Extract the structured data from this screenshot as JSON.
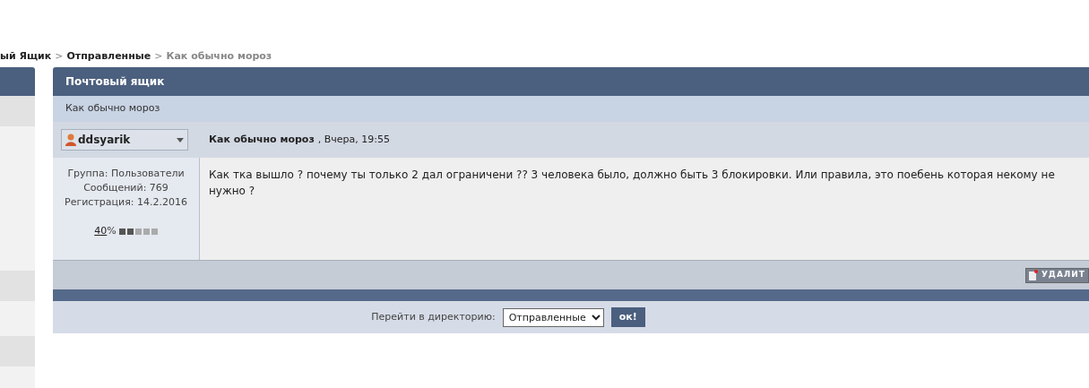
{
  "breadcrumb": [
    {
      "label": "ый Ящик",
      "current": false
    },
    {
      "label": "Отправленные",
      "current": false
    },
    {
      "label": "Как обычно мороз",
      "current": true
    }
  ],
  "breadcrumb_separator": ">",
  "panel": {
    "title": "Почтовый ящик",
    "subtitle": "Как обычно мороз"
  },
  "message": {
    "author": "ddsyarik",
    "subject": "Как обычно мороз",
    "date": ", Вчера, 19:55",
    "author_info": [
      "Группа: Пользователи",
      "Сообщений: 769",
      "Регистрация: 14.2.2016"
    ],
    "reputation": {
      "value": "40",
      "suffix": "%",
      "level": 0.4
    },
    "body": "Как тка вышло ? почему ты только 2 дал ограничени ?? 3 человека было, должно быть 3 блокировки. Или правила, это поебень которая некому не нужно ?",
    "delete_button": "УДАЛИТ"
  },
  "jump": {
    "label": "Перейти в директорию:",
    "value": "Отправленные",
    "button": "ок!"
  }
}
